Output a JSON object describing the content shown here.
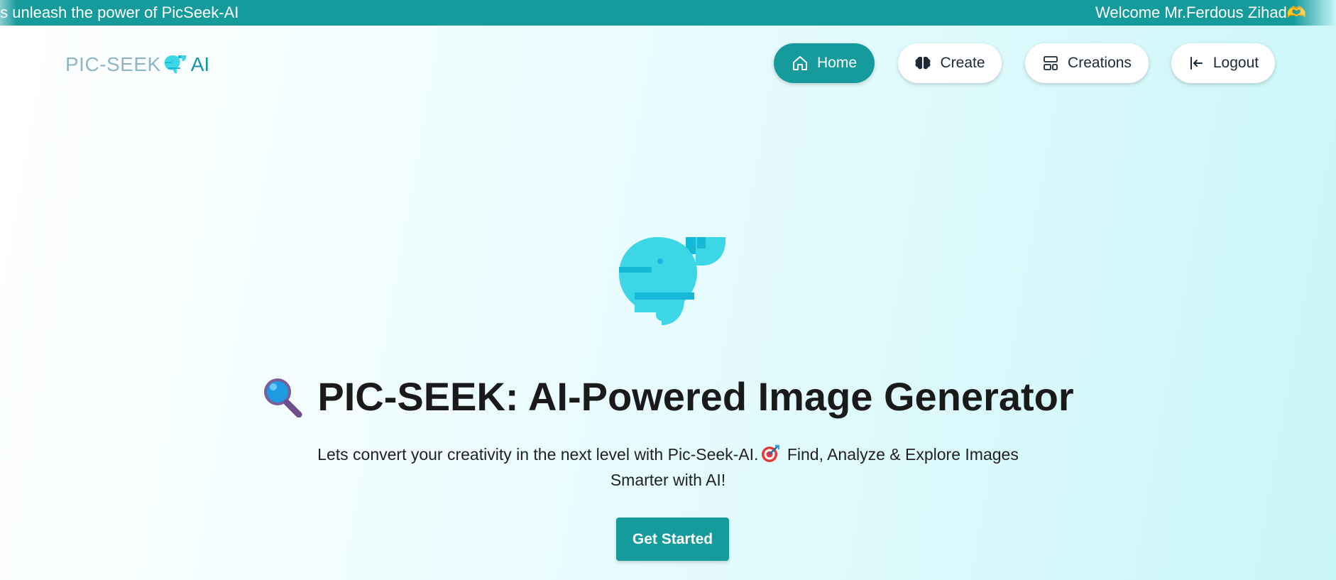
{
  "banner": {
    "left_text": "ts unleash the power of PicSeek-AI",
    "right_text": "Welcome Mr.Ferdous Zihad",
    "heart_icon": "heart-hands-icon"
  },
  "logo": {
    "part1": "PIC-SEEK",
    "part2": "AI",
    "icon": "whale-icon"
  },
  "nav": {
    "items": [
      {
        "label": "Home",
        "icon": "home-icon",
        "active": true
      },
      {
        "label": "Create",
        "icon": "brain-icon",
        "active": false
      },
      {
        "label": "Creations",
        "icon": "layout-icon",
        "active": false
      },
      {
        "label": "Logout",
        "icon": "logout-icon",
        "active": false
      }
    ]
  },
  "hero": {
    "icon": "whale-icon",
    "title_icon": "magnifying-glass-icon",
    "title": "PIC-SEEK: AI-Powered Image Generator",
    "subtitle_part1": "Lets convert your creativity in the next level with Pic-Seek-AI.",
    "subtitle_icon": "target-dart-icon",
    "subtitle_part2": " Find, Analyze & Explore Images Smarter with AI!",
    "cta_label": "Get Started"
  },
  "colors": {
    "accent": "#159b9c",
    "whale": "#3dd6e6",
    "whale_dark": "#16b8d8"
  }
}
